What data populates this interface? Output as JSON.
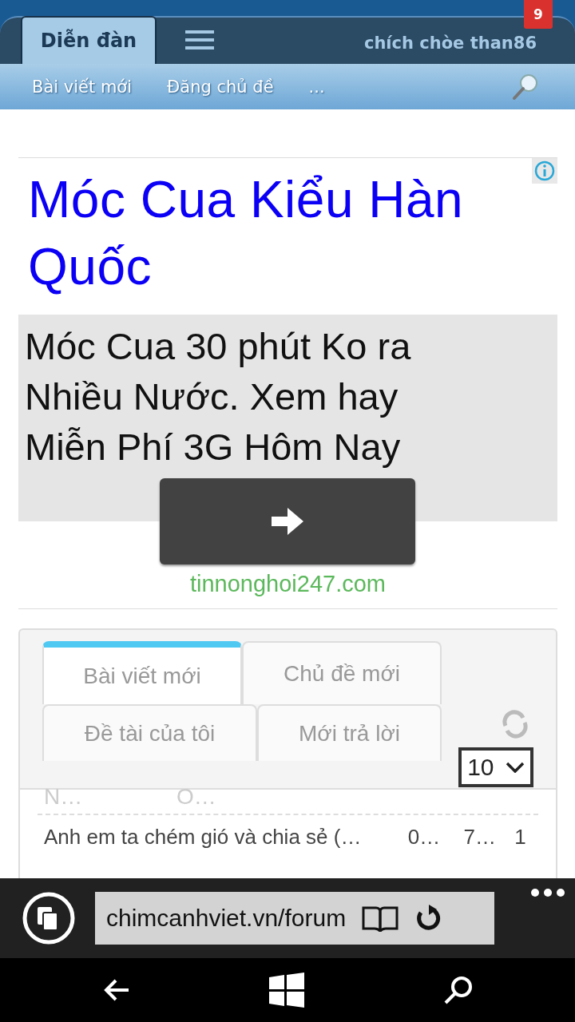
{
  "header": {
    "tabs": [
      {
        "label": "Diễn đàn",
        "selected": true
      }
    ],
    "username": "chích chòe than86",
    "badge": "9"
  },
  "subnav": {
    "links": [
      "Bài viết mới",
      "Đăng chủ đề",
      "..."
    ]
  },
  "ad": {
    "title": "Móc Cua Kiểu Hàn Quốc",
    "body": "Móc Cua 30 phút Ko ra Nhiều Nước. Xem hay Miễn Phí 3G Hôm Nay",
    "domain": "tinnonghoi247.com"
  },
  "widget": {
    "tabs": [
      {
        "label": "Bài viết mới",
        "selected": true
      },
      {
        "label": "Chủ đề mới",
        "selected": false
      },
      {
        "label": "Đề tài của tôi",
        "selected": false
      },
      {
        "label": "Mới trả lời",
        "selected": false
      }
    ],
    "page_size": "10",
    "scrolled_text": "N… O…",
    "rows": [
      {
        "cells": [
          "Anh em ta chém gió và chia sẻ (…",
          "0…",
          "7…",
          "1"
        ]
      }
    ]
  },
  "browser": {
    "url": "chimcanhviet.vn/forum"
  }
}
